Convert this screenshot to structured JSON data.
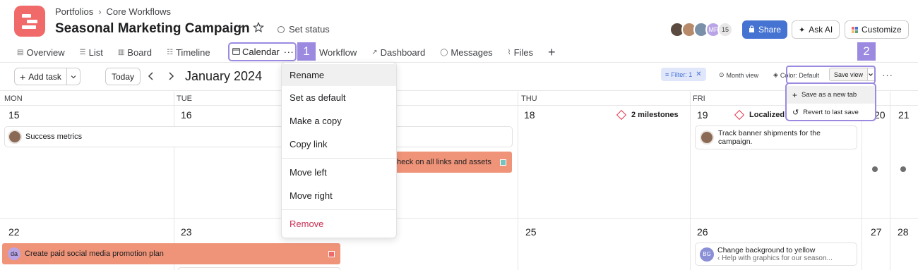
{
  "header": {
    "breadcrumbs": [
      "Portfolios",
      "Core Workflows"
    ],
    "breadcrumb_sep": "›",
    "title": "Seasonal Marketing Campaign",
    "set_status": "Set status",
    "member_overflow_initials": "MF",
    "member_count": "15",
    "share_label": "Share",
    "ask_ai_label": "Ask AI",
    "customize_label": "Customize"
  },
  "tabs": [
    {
      "label": "Overview",
      "icon": "overview-icon"
    },
    {
      "label": "List",
      "icon": "list-icon"
    },
    {
      "label": "Board",
      "icon": "board-icon"
    },
    {
      "label": "Timeline",
      "icon": "timeline-icon"
    },
    {
      "label": "Calendar",
      "icon": "calendar-icon",
      "selected": true
    },
    {
      "label": "Workflow",
      "icon": "workflow-icon"
    },
    {
      "label": "Dashboard",
      "icon": "dashboard-icon"
    },
    {
      "label": "Messages",
      "icon": "messages-icon"
    },
    {
      "label": "Files",
      "icon": "files-icon"
    }
  ],
  "markers": {
    "m1": "1",
    "m2": "2"
  },
  "toolbar": {
    "add_task": "Add task",
    "today": "Today",
    "month": "January 2024",
    "filter": "Filter: 1",
    "month_view": "Month view",
    "color": "Color: Default",
    "save_view": "Save view"
  },
  "calendar": {
    "days_of_week": [
      "MON",
      "TUE",
      "THU",
      "FRI"
    ],
    "week1": {
      "mon": "15",
      "tue": "16",
      "thu": "18",
      "fri": "19",
      "sat": "20",
      "sun": "21"
    },
    "week2": {
      "mon": "22",
      "tue": "23",
      "thu": "25",
      "fri": "26",
      "sat": "27",
      "sun": "28"
    },
    "events": {
      "success_metrics": "Success metrics",
      "check_links": "heck on all links and assets",
      "milestones": "2 milestones",
      "localized": "Localized",
      "track_banner": "Track banner shipments for the campaign.",
      "paid_social": "Create paid social media promotion plan",
      "paid_social_initials": "da",
      "change_bg": "Change background to yellow",
      "change_bg_parent": "‹ Help with graphics for our season...",
      "change_bg_initials": "BG"
    }
  },
  "tab_menu": {
    "items": [
      "Rename",
      "Set as default",
      "Make a copy",
      "Copy link",
      "Move left",
      "Move right",
      "Remove"
    ]
  },
  "save_menu": {
    "items": [
      "Save as a new tab",
      "Revert to last save"
    ]
  },
  "colors": {
    "accent_purple": "#9b8ae0",
    "brand_coral": "#f06a6a",
    "task_orange": "#f09479",
    "share_blue": "#4573d2"
  }
}
